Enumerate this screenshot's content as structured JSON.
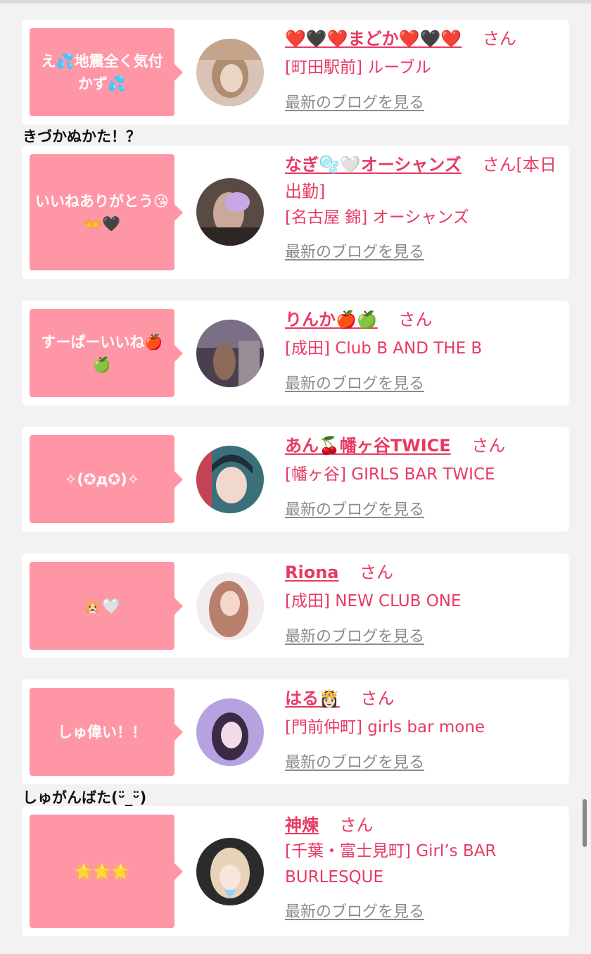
{
  "entries": [
    {
      "bubble": "え💦地震全く気付かず💦",
      "name": "❤️🖤❤️まどか❤️🖤❤️",
      "honorific": "さん",
      "shop": "[町田駅前] ルーブル",
      "blog_link": "最新のブログを見る",
      "avatar_icon": "profile-photo"
    },
    {
      "bubble": "いいねありがとう😘👐🖤",
      "name": "なぎ🫧🤍オーシャンズ",
      "honorific": "さん[本日出勤]",
      "shop": "[名古屋 錦] オーシャンズ",
      "blog_link": "最新のブログを見る",
      "avatar_icon": "profile-photo"
    },
    {
      "bubble": "すーぱーいいね🍎🍏",
      "name": "りんか🍎🍏",
      "honorific": "さん",
      "shop": "[成田] Club B AND THE B",
      "blog_link": "最新のブログを見る",
      "avatar_icon": "profile-photo"
    },
    {
      "bubble": "✧(✪д✪)✧",
      "name": "あん🍒幡ヶ谷TWICE",
      "honorific": "さん",
      "shop": "[幡ヶ谷] GIRLS BAR TWICE",
      "blog_link": "最新のブログを見る",
      "avatar_icon": "profile-photo"
    },
    {
      "bubble": "🐹🤍",
      "name": "Riona",
      "honorific": "さん",
      "shop": "[成田] NEW CLUB ONE",
      "blog_link": "最新のブログを見る",
      "avatar_icon": "profile-photo"
    },
    {
      "bubble": "しゅ偉い！！",
      "name": "はる👸🏻",
      "honorific": "さん",
      "shop": "[門前仲町] girls bar mone",
      "blog_link": "最新のブログを見る",
      "avatar_icon": "profile-photo"
    },
    {
      "bubble": "🌟🌟🌟",
      "name": "神煉",
      "honorific": "さん",
      "shop": "[千葉・富士見町] Girl’s BAR BURLESQUE",
      "blog_link": "最新のブログを見る",
      "avatar_icon": "profile-photo"
    }
  ],
  "comments": [
    "きづかぬかた！？",
    "しゅがんばた(ᵕ̈_ᵕ̈)"
  ],
  "colors": {
    "accent": "#e83a63",
    "bubble": "#ff96a6",
    "link_gray": "#8a8a8a",
    "background": "#f2f2f2"
  }
}
